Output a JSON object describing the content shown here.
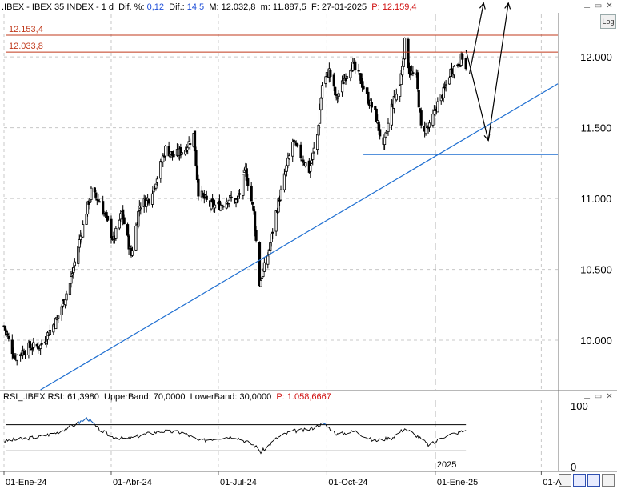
{
  "header": {
    "symbol": ".IBEX - IBEX 35 INDEX - 1 d",
    "dif_pct_label": "Dif. %:",
    "dif_pct_value": "0,12",
    "dif_label": "Dif.:",
    "dif_value": "14,5",
    "max_label": "M:",
    "max_value": "12.032,8",
    "min_label": "m:",
    "min_value": "11.887,5",
    "date_label": "F:",
    "date_value": "27-01-2025",
    "price_label": "P:",
    "price_value": "12.159,4"
  },
  "log_button": "Log",
  "rsi_header": {
    "name": "RSI_.IBEX",
    "rsi_label": "RSI:",
    "rsi_value": "61,3980",
    "upper_label": "UpperBand:",
    "upper_value": "70,0000",
    "lower_label": "LowerBand:",
    "lower_value": "30,0000",
    "p_label": "P:",
    "p_value": "1.058,6667"
  },
  "colors": {
    "candle": "#000000",
    "resistance": "#c0391b",
    "trendline": "#1f6fd1",
    "rsi_line": "#000000",
    "rsi_overbought": "#1f6fd1",
    "label_red": "#c0391b",
    "value_blue": "#1f4fd8",
    "value_red": "#d01010"
  },
  "chart_data": [
    {
      "type": "candlestick",
      "title": ".IBEX - IBEX 35 INDEX - 1 d",
      "y_axis": {
        "ticks": [
          "12.000",
          "11.500",
          "11.000",
          "10.500",
          "10.000"
        ],
        "tick_values": [
          12000,
          11500,
          11000,
          10500,
          10000
        ],
        "range": [
          9650,
          12300
        ],
        "grid": true
      },
      "x_axis": {
        "ticks": [
          "01-Ene-24",
          "01-Abr-24",
          "01-Jul-24",
          "01-Oct-24",
          "01-Ene-25",
          "01-A"
        ],
        "year_label": "2025",
        "range": [
          "2024-01-01",
          "2025-04-15"
        ]
      },
      "horizontal_lines": [
        {
          "label": "12.153,4",
          "value": 12153.4
        },
        {
          "label": "12.033,8",
          "value": 12033.8
        }
      ],
      "support_line": {
        "from": "2024-11-01",
        "to": "2025-04-15",
        "value": 11310
      },
      "trendline": {
        "points": [
          {
            "x": "2024-02-01",
            "y": 9650
          },
          {
            "x": "2025-04-15",
            "y": 11810
          }
        ]
      },
      "projection_arrows": [
        {
          "points": [
            {
              "x": "2025-01-27",
              "y": 12050
            },
            {
              "x": "2025-02-15",
              "y": 11410
            },
            {
              "x": "2025-03-04",
              "y": 12380
            }
          ]
        },
        {
          "points": [
            {
              "x": "2025-01-30",
              "y": 11880
            },
            {
              "x": "2025-02-11",
              "y": 12380
            }
          ]
        }
      ],
      "closes": [
        {
          "x": "2024-01-01",
          "y": 10100
        },
        {
          "x": "2024-01-10",
          "y": 9880
        },
        {
          "x": "2024-01-22",
          "y": 9950
        },
        {
          "x": "2024-02-01",
          "y": 9960
        },
        {
          "x": "2024-02-15",
          "y": 10150
        },
        {
          "x": "2024-02-26",
          "y": 10400
        },
        {
          "x": "2024-03-05",
          "y": 10700
        },
        {
          "x": "2024-03-15",
          "y": 11050
        },
        {
          "x": "2024-03-22",
          "y": 10980
        },
        {
          "x": "2024-03-28",
          "y": 10850
        },
        {
          "x": "2024-04-03",
          "y": 10700
        },
        {
          "x": "2024-04-10",
          "y": 10900
        },
        {
          "x": "2024-04-18",
          "y": 10600
        },
        {
          "x": "2024-04-25",
          "y": 10950
        },
        {
          "x": "2024-05-03",
          "y": 11000
        },
        {
          "x": "2024-05-10",
          "y": 11150
        },
        {
          "x": "2024-05-17",
          "y": 11350
        },
        {
          "x": "2024-05-24",
          "y": 11300
        },
        {
          "x": "2024-06-03",
          "y": 11350
        },
        {
          "x": "2024-06-10",
          "y": 11450
        },
        {
          "x": "2024-06-14",
          "y": 11050
        },
        {
          "x": "2024-06-24",
          "y": 10950
        },
        {
          "x": "2024-07-02",
          "y": 10950
        },
        {
          "x": "2024-07-10",
          "y": 11000
        },
        {
          "x": "2024-07-17",
          "y": 10980
        },
        {
          "x": "2024-07-24",
          "y": 11200
        },
        {
          "x": "2024-07-31",
          "y": 10900
        },
        {
          "x": "2024-08-05",
          "y": 10400
        },
        {
          "x": "2024-08-12",
          "y": 10600
        },
        {
          "x": "2024-08-19",
          "y": 10900
        },
        {
          "x": "2024-08-26",
          "y": 11150
        },
        {
          "x": "2024-09-02",
          "y": 11400
        },
        {
          "x": "2024-09-09",
          "y": 11300
        },
        {
          "x": "2024-09-16",
          "y": 11200
        },
        {
          "x": "2024-09-23",
          "y": 11450
        },
        {
          "x": "2024-09-27",
          "y": 11800
        },
        {
          "x": "2024-10-03",
          "y": 11900
        },
        {
          "x": "2024-10-09",
          "y": 11700
        },
        {
          "x": "2024-10-16",
          "y": 11850
        },
        {
          "x": "2024-10-22",
          "y": 11950
        },
        {
          "x": "2024-10-29",
          "y": 11850
        },
        {
          "x": "2024-11-05",
          "y": 11700
        },
        {
          "x": "2024-11-11",
          "y": 11600
        },
        {
          "x": "2024-11-18",
          "y": 11350
        },
        {
          "x": "2024-11-25",
          "y": 11650
        },
        {
          "x": "2024-12-02",
          "y": 11800
        },
        {
          "x": "2024-12-06",
          "y": 12100
        },
        {
          "x": "2024-12-10",
          "y": 11900
        },
        {
          "x": "2024-12-16",
          "y": 11850
        },
        {
          "x": "2024-12-20",
          "y": 11500
        },
        {
          "x": "2024-12-27",
          "y": 11500
        },
        {
          "x": "2025-01-02",
          "y": 11650
        },
        {
          "x": "2025-01-08",
          "y": 11750
        },
        {
          "x": "2025-01-14",
          "y": 11900
        },
        {
          "x": "2025-01-20",
          "y": 11950
        },
        {
          "x": "2025-01-24",
          "y": 12000
        },
        {
          "x": "2025-01-27",
          "y": 11910
        }
      ]
    },
    {
      "type": "line",
      "title": "RSI_.IBEX",
      "y_axis": {
        "ticks": [
          "100",
          "0"
        ],
        "tick_values": [
          100,
          0
        ],
        "range": [
          0,
          100
        ]
      },
      "bands": [
        {
          "label": "UpperBand",
          "value": 70
        },
        {
          "label": "LowerBand",
          "value": 30
        }
      ],
      "series": [
        {
          "name": "RSI",
          "values": [
            {
              "x": "2024-01-01",
              "y": 45
            },
            {
              "x": "2024-01-15",
              "y": 48
            },
            {
              "x": "2024-02-01",
              "y": 52
            },
            {
              "x": "2024-02-15",
              "y": 58
            },
            {
              "x": "2024-03-01",
              "y": 70
            },
            {
              "x": "2024-03-12",
              "y": 80
            },
            {
              "x": "2024-03-20",
              "y": 65
            },
            {
              "x": "2024-04-01",
              "y": 52
            },
            {
              "x": "2024-04-15",
              "y": 48
            },
            {
              "x": "2024-05-01",
              "y": 56
            },
            {
              "x": "2024-05-15",
              "y": 60
            },
            {
              "x": "2024-06-01",
              "y": 58
            },
            {
              "x": "2024-06-15",
              "y": 45
            },
            {
              "x": "2024-07-01",
              "y": 50
            },
            {
              "x": "2024-07-15",
              "y": 52
            },
            {
              "x": "2024-08-01",
              "y": 38
            },
            {
              "x": "2024-08-06",
              "y": 28
            },
            {
              "x": "2024-08-20",
              "y": 50
            },
            {
              "x": "2024-09-01",
              "y": 60
            },
            {
              "x": "2024-09-15",
              "y": 62
            },
            {
              "x": "2024-09-28",
              "y": 72
            },
            {
              "x": "2024-10-10",
              "y": 55
            },
            {
              "x": "2024-10-25",
              "y": 60
            },
            {
              "x": "2024-11-10",
              "y": 45
            },
            {
              "x": "2024-11-25",
              "y": 50
            },
            {
              "x": "2024-12-06",
              "y": 64
            },
            {
              "x": "2024-12-15",
              "y": 55
            },
            {
              "x": "2024-12-27",
              "y": 38
            },
            {
              "x": "2025-01-08",
              "y": 52
            },
            {
              "x": "2025-01-20",
              "y": 58
            },
            {
              "x": "2025-01-27",
              "y": 61.398
            }
          ]
        }
      ]
    }
  ]
}
